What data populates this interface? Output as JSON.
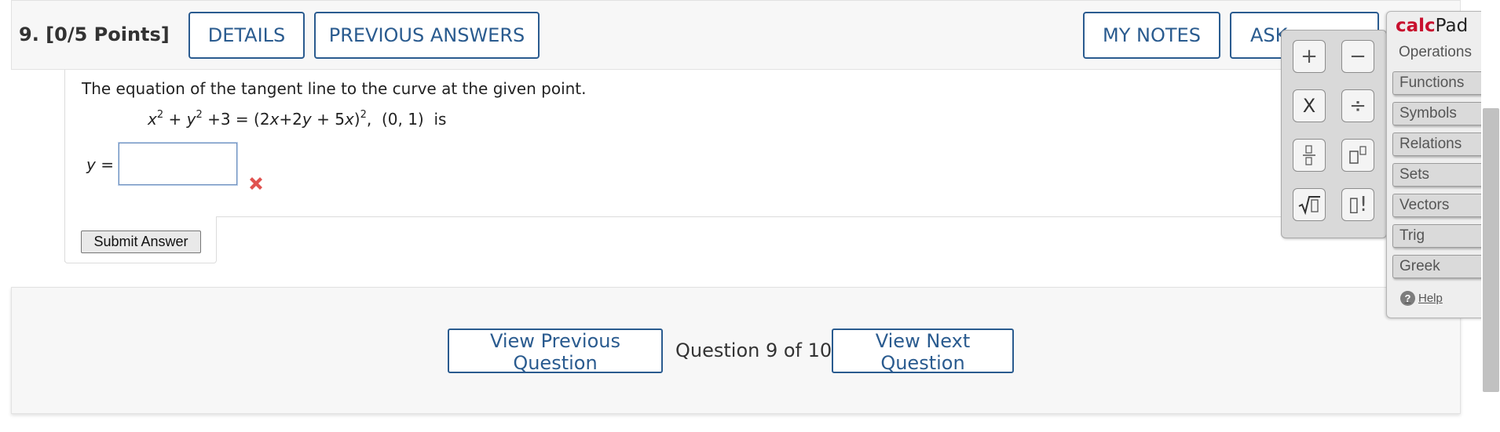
{
  "header": {
    "question_label": "9.  [0/5 Points]",
    "details": "DETAILS",
    "previous_answers": "PREVIOUS ANSWERS",
    "my_notes": "MY NOTES",
    "ask": "ASK"
  },
  "question": {
    "prompt": "The equation of the tangent line to the curve at the given point.",
    "equation": {
      "x": "x",
      "exp1": "2",
      "plus1": " + ",
      "y": "y",
      "exp2": "2",
      "rest1": " +3 = (2",
      "x2": "x",
      "mid": "+2",
      "y2": "y",
      "plus5": " + 5",
      "x3": "x",
      "close": ")",
      "exp3": "2",
      "point": ",  (0, 1)  is"
    },
    "answer_label_var": "y",
    "answer_label_eq": " =",
    "answer_value": "",
    "status": "incorrect"
  },
  "submit": {
    "label": "Submit Answer"
  },
  "footer": {
    "prev": "View Previous Question",
    "count": "Question 9 of 10",
    "next": "View Next Question"
  },
  "calcpad": {
    "title_a": "calc",
    "title_b": "Pad",
    "tabs": [
      "Operations",
      "Functions",
      "Symbols",
      "Relations",
      "Sets",
      "Vectors",
      "Trig",
      "Greek"
    ],
    "active_tab": "Operations",
    "help": "Help",
    "ops": {
      "plus": "+",
      "minus": "−",
      "times": "X",
      "divide": "÷",
      "factorial": "▯!"
    }
  },
  "colors": {
    "primary": "#2a5b8f",
    "error": "#e0524f",
    "calcpad_brand": "#c8102e"
  }
}
